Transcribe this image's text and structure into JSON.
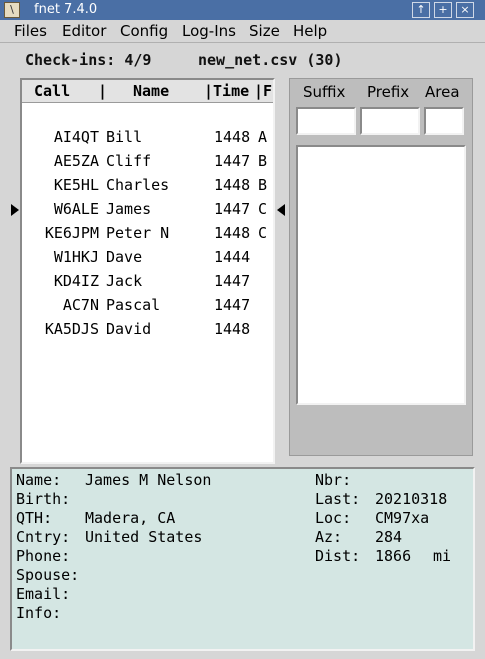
{
  "window": {
    "title": "fnet 7.4.0",
    "app_icon_glyph": "\\"
  },
  "titlebar_buttons": [
    "↑",
    "+",
    "×"
  ],
  "menu": [
    "Files",
    "Editor",
    "Config",
    "Log-Ins",
    "Size",
    "Help"
  ],
  "status": {
    "checkins": "Check-ins: 4/9",
    "filename": "new_net.csv (30)"
  },
  "list": {
    "headers": {
      "call": "Call",
      "sep": "|",
      "name": "Name",
      "time": "|Time",
      "flag": "|F"
    },
    "rows": [
      {
        "call": "AI4QT",
        "name": "Bill",
        "time": "1448",
        "flag": "A"
      },
      {
        "call": "AE5ZA",
        "name": "Cliff",
        "time": "1447",
        "flag": "B"
      },
      {
        "call": "KE5HL",
        "name": "Charles",
        "time": "1448",
        "flag": "B"
      },
      {
        "call": "W6ALE",
        "name": "James",
        "time": "1447",
        "flag": "C"
      },
      {
        "call": "KE6JPM",
        "name": "Peter N",
        "time": "1448",
        "flag": "C"
      },
      {
        "call": "W1HKJ",
        "name": "Dave",
        "time": "1444",
        "flag": ""
      },
      {
        "call": "KD4IZ",
        "name": "Jack",
        "time": "1447",
        "flag": ""
      },
      {
        "call": "AC7N",
        "name": "Pascal",
        "time": "1447",
        "flag": ""
      },
      {
        "call": "KA5DJS",
        "name": "David",
        "time": "1448",
        "flag": ""
      }
    ]
  },
  "search": {
    "suffix_label": "Suffix",
    "prefix_label": "Prefix",
    "area_label": "Area",
    "suffix_value": "",
    "prefix_value": "",
    "area_value": ""
  },
  "info": {
    "left": [
      {
        "label": "Name:",
        "value": "James M Nelson"
      },
      {
        "label": "Birth:",
        "value": ""
      },
      {
        "label": "QTH:",
        "value": "Madera, CA"
      },
      {
        "label": "Cntry:",
        "value": "United States"
      },
      {
        "label": "Phone:",
        "value": ""
      },
      {
        "label": "Spouse:",
        "value": ""
      },
      {
        "label": "Email:",
        "value": ""
      },
      {
        "label": "Info:",
        "value": ""
      }
    ],
    "right": [
      {
        "label": "Nbr:",
        "value": ""
      },
      {
        "label": "Last:",
        "value": "20210318"
      },
      {
        "label": "Loc:",
        "value": "CM97xa"
      },
      {
        "label": "Az:",
        "value": "284"
      },
      {
        "label": "Dist:",
        "value": "1866",
        "unit": "mi"
      }
    ]
  }
}
